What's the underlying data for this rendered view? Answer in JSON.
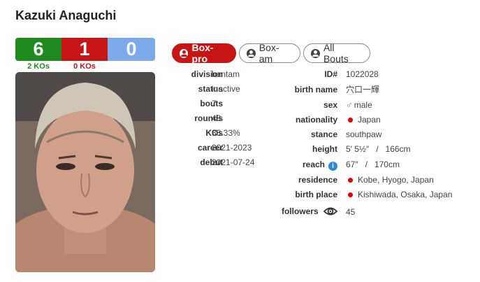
{
  "boxer": {
    "name": "Kazuki Anaguchi"
  },
  "record": {
    "wins": "6",
    "losses": "1",
    "draws": "0",
    "win_kos": "2 KOs",
    "loss_kos": "0 KOs"
  },
  "tabs": [
    {
      "label": "Box-pro",
      "active": true
    },
    {
      "label": "Box-am",
      "active": false
    },
    {
      "label": "All Bouts",
      "active": false
    }
  ],
  "left_info": [
    {
      "label": "division",
      "value": "bantam"
    },
    {
      "label": "status",
      "value": "inactive"
    },
    {
      "label": "bouts",
      "value": "7"
    },
    {
      "label": "rounds",
      "value": "48"
    },
    {
      "label": "KOs",
      "value": "33.33%"
    },
    {
      "label": "career",
      "value": "2021-2023"
    },
    {
      "label": "debut",
      "value": "2021-07-24"
    }
  ],
  "right_info": {
    "id": {
      "label": "ID#",
      "value": "1022028"
    },
    "birth_name": {
      "label": "birth name",
      "value": "穴口一輝"
    },
    "sex": {
      "label": "sex",
      "value": "male"
    },
    "nationality": {
      "label": "nationality",
      "value": "Japan"
    },
    "stance": {
      "label": "stance",
      "value": "southpaw"
    },
    "height": {
      "label": "height",
      "value": "5′ 5½″   /   166cm"
    },
    "reach": {
      "label": "reach",
      "value": "67″   /   170cm"
    },
    "residence": {
      "label": "residence",
      "value": "Kobe, Hyogo, Japan"
    },
    "birth_place": {
      "label": "birth place",
      "value": "Kishiwada, Osaka, Japan"
    },
    "followers": {
      "label": "followers",
      "value": "45"
    }
  },
  "colors": {
    "win": "#1f8a1f",
    "loss": "#c71414",
    "draw": "#7ba9ea",
    "flag_dot": "#dd0000"
  },
  "icons": {
    "tab_icon": "user-circle-icon",
    "sex_icon": "male-symbol-icon",
    "reach_icon": "info-icon",
    "followers_icon": "eye-icon",
    "nationality_icon": "red-dot-flag-icon"
  }
}
